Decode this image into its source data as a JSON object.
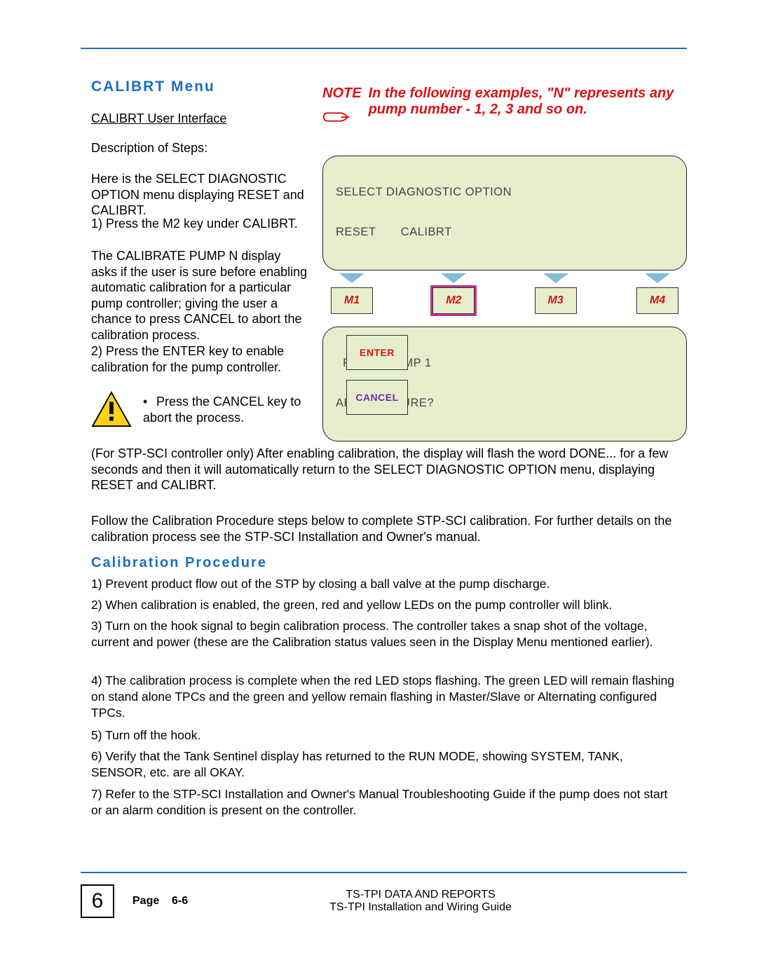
{
  "headings": {
    "calibrt_menu": "CALIBRT Menu",
    "calib_proc": "Calibration Procedure"
  },
  "left": {
    "ui_label": "CALIBRT User Interface",
    "desc_label": "Description of Steps:",
    "p_intro": "Here is the SELECT DIAGNOSTIC OPTION menu displaying RESET and CALIBRT.",
    "step1": "1) Press the M2 key under CALIBRT.",
    "p_calib": "The CALIBRATE PUMP N display asks if the user is sure before enabling automatic calibration for a particular pump controller; giving the user a chance to press CANCEL to abort the calibration process.",
    "step2": "2) Press the ENTER key to enable calibration for the pump controller.",
    "cancel_bullet": "Press the CANCEL key to abort the process."
  },
  "note": {
    "label": "NOTE",
    "text": "In the following examples, \"N\" represents any pump number - 1, 2, 3 and so on."
  },
  "lcd1": {
    "line1": "SELECT DIAGNOSTIC OPTION",
    "line2": "RESET       CALIBRT"
  },
  "mkeys": {
    "m1": "M1",
    "m2": "M2",
    "m3": "M3",
    "m4": "M4"
  },
  "lcd2": {
    "line1": "  RESET PUMP 1",
    "line2": "ARE YOU SURE?"
  },
  "keys": {
    "enter": "ENTER",
    "cancel": "CANCEL"
  },
  "full": {
    "p_done": "(For STP-SCI controller only) After enabling calibration, the display will flash the word DONE... for a few seconds and then it will automatically return to the SELECT DIAGNOSTIC OPTION menu, displaying RESET and CALIBRT.",
    "p_follow": "Follow the Calibration Procedure steps below to complete STP-SCI calibration.  For further details on the calibration process see the STP-SCI Installation and Owner's manual.",
    "c1": "1) Prevent product flow out of the STP by closing a ball valve at the pump discharge.",
    "c2": "2)  When calibration is enabled, the green, red and yellow LEDs on the pump controller will blink.",
    "c3": "3) Turn on the hook signal  to begin calibration process. The controller takes a snap shot of the voltage, current and power (these are the Calibration status values seen in the Display Menu mentioned earlier).",
    "c4": "4) The calibration process is complete when the red LED stops flashing. The green LED will remain flashing on stand alone TPCs and the green and yellow remain flashing in Master/Slave or Alternating configured TPCs.",
    "c5": "5) Turn off the hook.",
    "c6": "6) Verify that the Tank Sentinel display has returned to the RUN MODE, showing SYSTEM, TANK, SENSOR, etc. are all OKAY.",
    "c7": "7) Refer to the STP-SCI Installation and Owner's Manual Troubleshooting Guide if the pump does not start or an alarm condition is present on the controller."
  },
  "footer": {
    "chapter": "6",
    "page_label": "Page",
    "page_num": "6-6",
    "title1": "TS-TPI DATA AND REPORTS",
    "title2": "TS-TPI Installation and Wiring Guide"
  }
}
